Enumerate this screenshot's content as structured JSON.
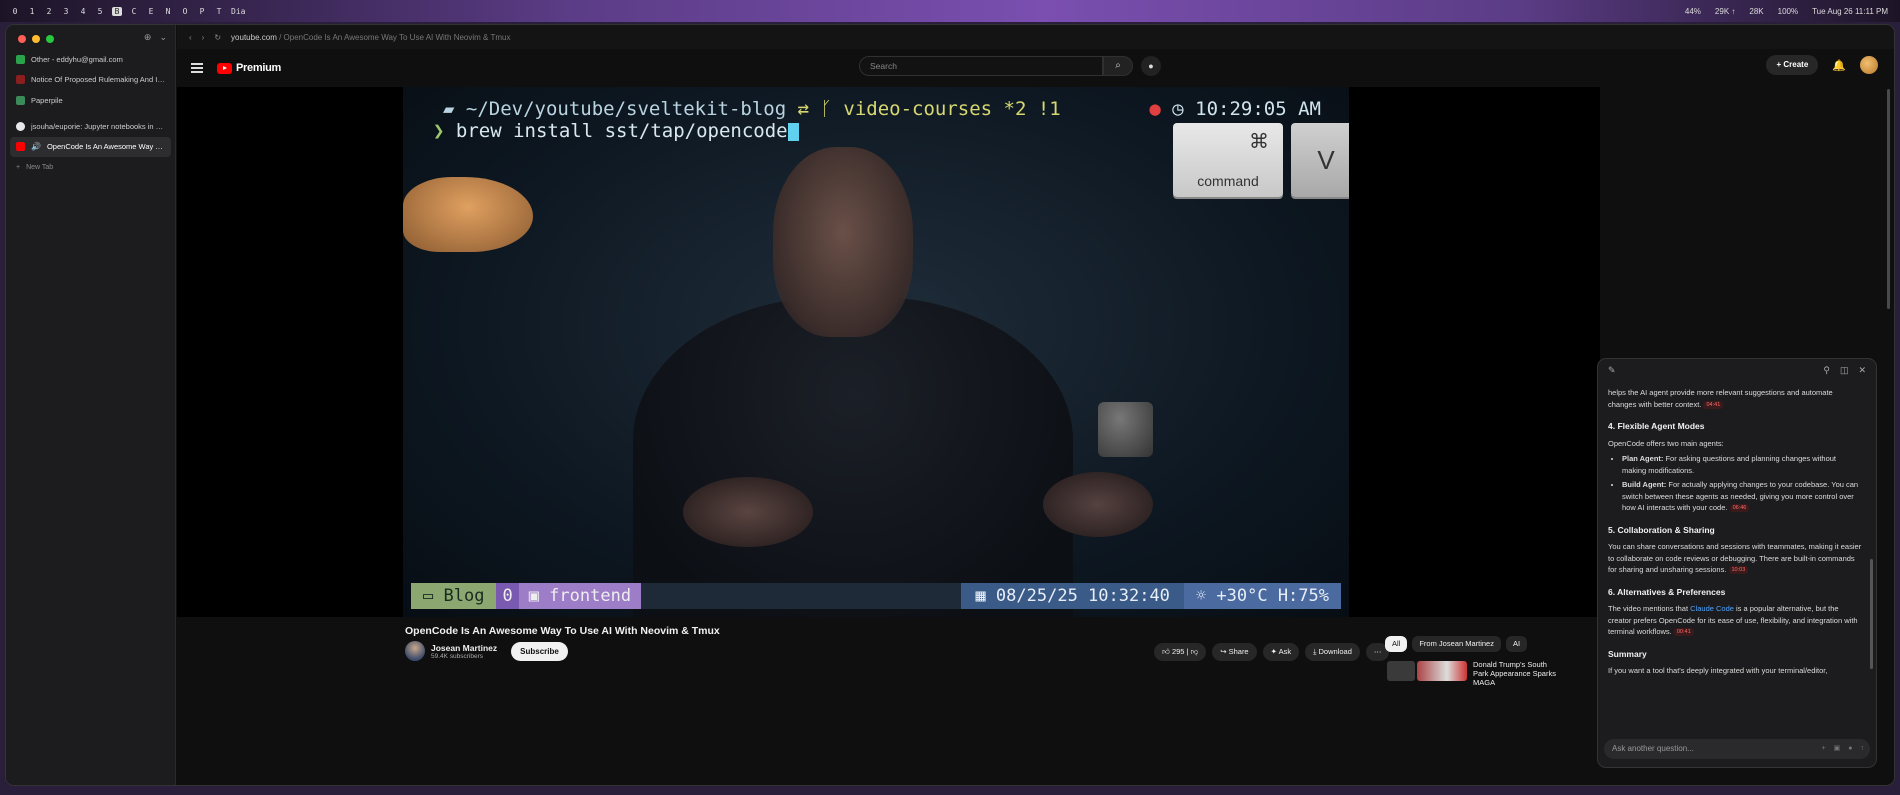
{
  "menubar": {
    "spaces": [
      "0",
      "1",
      "2",
      "3",
      "4",
      "5",
      "B",
      "C",
      "E",
      "N",
      "O",
      "P",
      "T",
      "Dia"
    ],
    "active_space": "B",
    "status": [
      "44%",
      "29K ↑",
      "28K",
      "100%",
      "Tue Aug 26  11:11 PM"
    ]
  },
  "sidebar": {
    "tabs": [
      {
        "label": "Other - eddyhu@gmail.com",
        "icon": "sheets-icon",
        "color": "#2ba24c"
      },
      {
        "label": "Notice Of Proposed Rulemaking And Issuance",
        "icon": "document-icon",
        "color": "#8b1e1e"
      },
      {
        "label": "Paperpile",
        "icon": "paperpile-icon",
        "color": "#3a8a5a"
      },
      {
        "label": "jsouha/euporie: Jupyter notebooks in the terminal",
        "icon": "github-icon",
        "color": "#e8e8e8"
      },
      {
        "label": "OpenCode Is An Awesome Way To Use AI With Neovim & Tmux",
        "icon": "youtube-icon",
        "color": "#ff0000"
      }
    ],
    "new_tab": "New Tab"
  },
  "toolbar": {
    "url_host": "youtube.com",
    "url_path": "/ OpenCode Is An Awesome Way To Use AI With Neovim & Tmux"
  },
  "header": {
    "brand": "Premium",
    "search_placeholder": "Search",
    "create_label": "Create"
  },
  "video_frame": {
    "prompt_path": "~/Dev/youtube/sveltekit-blog",
    "branch": "video-courses *2 !1",
    "clock": "10:29:05 AM",
    "command": "brew install sst/tap/opencode",
    "key_command_symbol": "⌘",
    "key_command_word": "command",
    "key_v": "V",
    "tmux_session": "Blog",
    "tmux_window_num": "0",
    "tmux_window_name": "frontend",
    "tmux_datetime": "08/25/25 10:32:40",
    "tmux_weather": "+30°C H:75%"
  },
  "video": {
    "title": "OpenCode Is An Awesome Way To Use AI With Neovim & Tmux",
    "channel_name": "Josean Martinez",
    "subscribers": "59.4K subscribers",
    "subscribe_label": "Subscribe",
    "likes": "295",
    "share_label": "Share",
    "ask_label": "Ask",
    "download_label": "Download"
  },
  "chips": [
    "All",
    "From Josean Martinez",
    "AI"
  ],
  "recommendation": {
    "title": "Donald Trump's South Park Appearance Sparks MAGA"
  },
  "ai_panel": {
    "intro": "helps the AI agent provide more relevant suggestions and automate changes with better context.",
    "intro_ts": "04:41",
    "s4_title": "4. Flexible Agent Modes",
    "s4_text": "OpenCode offers two main agents:",
    "s4_plan_label": "Plan Agent:",
    "s4_plan_text": " For asking questions and planning changes without making modifications.",
    "s4_build_label": "Build Agent:",
    "s4_build_text": " For actually applying changes to your codebase. You can switch between these agents as needed, giving you more control over how AI interacts with your code.",
    "s4_ts": "06:46",
    "s5_title": "5. Collaboration & Sharing",
    "s5_text": "You can share conversations and sessions with teammates, making it easier to collaborate on code reviews or debugging. There are built-in commands for sharing and unsharing sessions.",
    "s5_ts": "10:03",
    "s6_title": "6. Alternatives & Preferences",
    "s6_text_a": "The video mentions that ",
    "s6_link": "Claude Code",
    "s6_text_b": " is a popular alternative, but the creator prefers OpenCode for its ease of use, flexibility, and integration with terminal workflows.",
    "s6_ts": "00:41",
    "summary_title": "Summary",
    "summary_text": "If you want a tool that's deeply integrated with your terminal/editor,",
    "input_placeholder": "Ask another question..."
  }
}
